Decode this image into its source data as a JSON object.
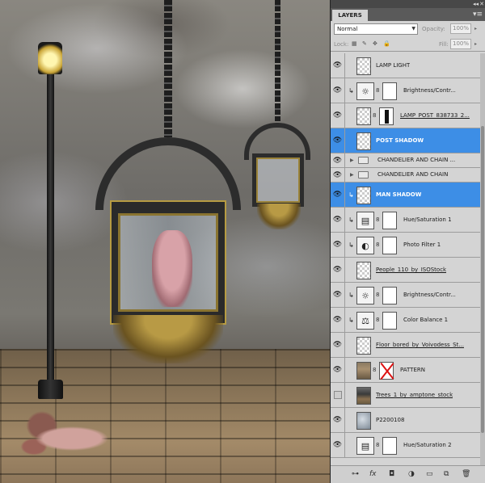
{
  "panel": {
    "tab_label": "LAYERS",
    "collapse_glyph": "◂◂",
    "close_glyph": "✕",
    "menu_glyph": "▾≡",
    "blend_mode": "Normal",
    "opacity_label": "Opacity:",
    "opacity_value": "100%",
    "lock_label": "Lock:",
    "fill_label": "Fill:",
    "fill_value": "100%"
  },
  "layers": [
    {
      "name": "LAMP LIGHT",
      "visible": true,
      "type": "pixel"
    },
    {
      "name": "Brightness/Contr...",
      "visible": true,
      "type": "adjustment",
      "icon": "☼",
      "clipped": true
    },
    {
      "name": "LAMP_POST_838733_2...",
      "visible": true,
      "type": "pixel-mask",
      "underline": true
    },
    {
      "name": "POST SHADOW",
      "visible": true,
      "type": "pixel",
      "selected": true
    },
    {
      "name": "CHANDELIER AND CHAIN ...",
      "visible": true,
      "type": "group"
    },
    {
      "name": "CHANDELIER AND CHAIN",
      "visible": true,
      "type": "group"
    },
    {
      "name": "MAN SHADOW",
      "visible": true,
      "type": "pixel",
      "selected": true,
      "clipped": true
    },
    {
      "name": "Hue/Saturation 1",
      "visible": true,
      "type": "adjustment",
      "icon": "▤",
      "clipped": true
    },
    {
      "name": "Photo Filter 1",
      "visible": true,
      "type": "adjustment",
      "icon": "◐",
      "clipped": true
    },
    {
      "name": "People_110_by_ISOStock",
      "visible": true,
      "type": "pixel",
      "underline": true
    },
    {
      "name": "Brightness/Contr...",
      "visible": true,
      "type": "adjustment",
      "icon": "☼",
      "clipped": true
    },
    {
      "name": "Color Balance 1",
      "visible": true,
      "type": "adjustment",
      "icon": "⚖",
      "clipped": true
    },
    {
      "name": "Floor_bored_by_Voivodess_St...",
      "visible": true,
      "type": "pixel",
      "underline": true
    },
    {
      "name": "PATTERN",
      "visible": true,
      "type": "pixel-redmask"
    },
    {
      "name": "Trees_1_by_amptone_stock",
      "visible": false,
      "type": "photo-dark",
      "underline": true
    },
    {
      "name": "P2200108",
      "visible": true,
      "type": "photo-sky"
    },
    {
      "name": "Hue/Saturation 2",
      "visible": true,
      "type": "adjustment",
      "icon": "▤"
    }
  ],
  "footer_icons": [
    "link-icon",
    "fx-icon",
    "add-mask-icon",
    "adjustment-icon",
    "group-folder-icon",
    "new-layer-icon",
    "trash-icon"
  ],
  "glyphs": {
    "eye": "👁",
    "clip": "↳",
    "link": "8",
    "disclosure": "▶",
    "fx": "fx"
  }
}
